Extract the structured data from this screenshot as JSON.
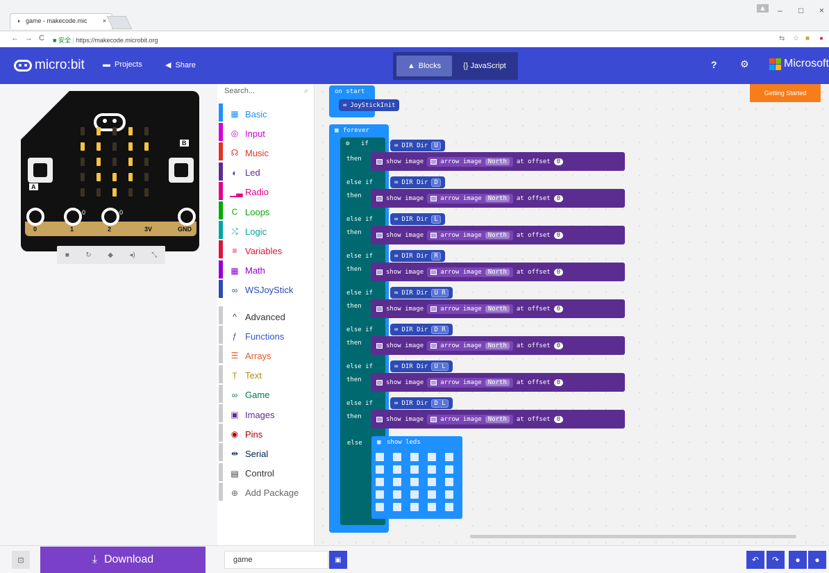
{
  "browser": {
    "tab_title": "game - makecode.mic",
    "tab_close": "×",
    "secure_label": "安全",
    "url": "https://makecode.microbit.org",
    "win_min": "–",
    "win_max": "□",
    "win_close": "×"
  },
  "header": {
    "logo_text": "micro:bit",
    "projects_label": "Projects",
    "share_label": "Share",
    "blocks_label": "Blocks",
    "javascript_label": "{} JavaScript",
    "microsoft_label": "Microsoft",
    "getting_started_label": "Getting Started",
    "microsoft_colors": [
      "#f25022",
      "#7fba00",
      "#00a4ef",
      "#ffb900"
    ]
  },
  "simulator": {
    "button_a": "A",
    "button_b": "B",
    "pins": [
      "0",
      "1",
      "2",
      "3V",
      "GND"
    ],
    "pin_small": [
      "0",
      "0",
      "0"
    ],
    "led_on_color": "#f5c242",
    "led_off_color": "#3a3322"
  },
  "toolbox": {
    "search_placeholder": "Search...",
    "categories": [
      {
        "label": "Basic",
        "color": "#1e90ff",
        "icon": "grid-icon"
      },
      {
        "label": "Input",
        "color": "#d400d4",
        "icon": "target-icon"
      },
      {
        "label": "Music",
        "color": "#e63022",
        "icon": "headphones-icon"
      },
      {
        "label": "Led",
        "color": "#5c2d91",
        "icon": "toggle-icon"
      },
      {
        "label": "Radio",
        "color": "#e3008c",
        "icon": "signal-icon"
      },
      {
        "label": "Loops",
        "color": "#00aa00",
        "icon": "loop-icon"
      },
      {
        "label": "Logic",
        "color": "#00a4a6",
        "icon": "shuffle-icon"
      },
      {
        "label": "Variables",
        "color": "#dc143c",
        "icon": "list-icon"
      },
      {
        "label": "Math",
        "color": "#9400d3",
        "icon": "calculator-icon"
      },
      {
        "label": "WSJoyStick",
        "color": "#2d4ab5",
        "icon": "joystick-icon"
      }
    ],
    "advanced": [
      {
        "label": "Advanced",
        "color": "#333333",
        "icon": "chevron-up-icon"
      },
      {
        "label": "Functions",
        "color": "#3455db",
        "icon": "function-icon"
      },
      {
        "label": "Arrays",
        "color": "#e65722",
        "icon": "arrays-icon"
      },
      {
        "label": "Text",
        "color": "#b8860b",
        "icon": "text-icon"
      },
      {
        "label": "Game",
        "color": "#007a4b",
        "icon": "game-icon"
      },
      {
        "label": "Images",
        "color": "#5c2d91",
        "icon": "image-icon"
      },
      {
        "label": "Pins",
        "color": "#a80000",
        "icon": "pin-icon"
      },
      {
        "label": "Serial",
        "color": "#002050",
        "icon": "usb-icon"
      },
      {
        "label": "Control",
        "color": "#333333",
        "icon": "control-icon"
      },
      {
        "label": "Add Package",
        "color": "#666666",
        "icon": "plus-circle-icon"
      }
    ]
  },
  "blocks": {
    "on_start": "on start",
    "joystick_init": "JoyStickInit",
    "forever": "forever",
    "if_kw": "if",
    "then_kw": "then",
    "else_if_kw": "else if",
    "else_kw": "else",
    "dir_label": "DIR Dir",
    "show_image": "show image",
    "arrow_image": "arrow image",
    "north": "North",
    "at_offset": "at offset",
    "offset_value": "0",
    "show_leds": "show leds",
    "branches": [
      "U",
      "D",
      "L",
      "R",
      "U R",
      "D R",
      "U L",
      "D L"
    ]
  },
  "bottom": {
    "download_label": "Download",
    "project_name": "game"
  }
}
